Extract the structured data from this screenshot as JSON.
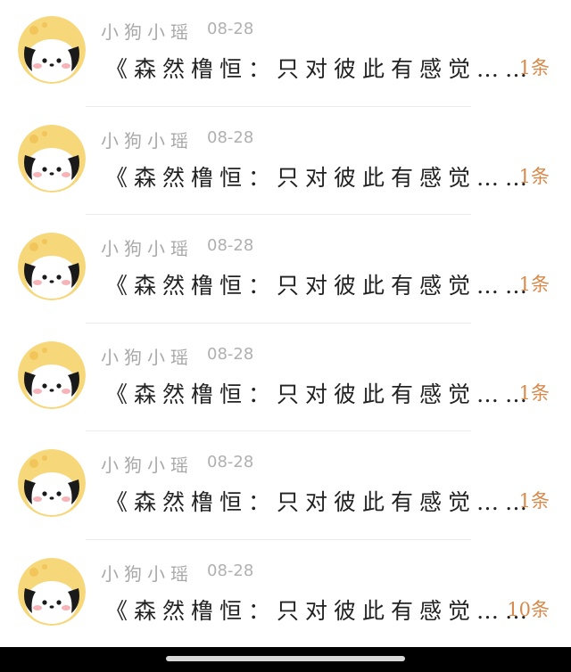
{
  "items": [
    {
      "name": "小狗小瑶",
      "date": "08-28",
      "message": "《森然橹恒：只对彼此有感觉……",
      "count": "1条"
    },
    {
      "name": "小狗小瑶",
      "date": "08-28",
      "message": "《森然橹恒：只对彼此有感觉……",
      "count": "1条"
    },
    {
      "name": "小狗小瑶",
      "date": "08-28",
      "message": "《森然橹恒：只对彼此有感觉……",
      "count": "1条"
    },
    {
      "name": "小狗小瑶",
      "date": "08-28",
      "message": "《森然橹恒：只对彼此有感觉……",
      "count": "1条"
    },
    {
      "name": "小狗小瑶",
      "date": "08-28",
      "message": "《森然橹恒：只对彼此有感觉……",
      "count": "1条"
    },
    {
      "name": "小狗小瑶",
      "date": "08-28",
      "message": "《森然橹恒：只对彼此有感觉……",
      "count": "10条"
    }
  ],
  "colors": {
    "name": "#a8a8a8",
    "message": "#222222",
    "count": "#d7894a",
    "avatar_bg": "#f6d77a"
  },
  "icons": {
    "avatar": "puppy-avatar-icon",
    "home": "home-indicator"
  }
}
